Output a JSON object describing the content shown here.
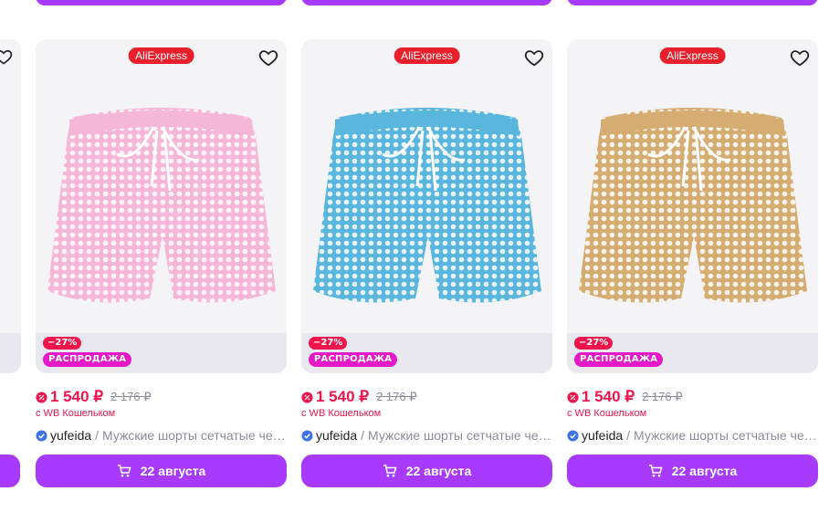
{
  "colors": {
    "accent": "#a73afd",
    "price": "#f0144d",
    "sale": "#e619c9",
    "aliexpress": "#e8202b"
  },
  "products": [
    {
      "store": "AliExpress",
      "discount": "−27%",
      "sale_label": "РАСПРОДАЖА",
      "price": "1 540 ₽",
      "old_price": "2 176 ₽",
      "wallet_note": "с WB Кошельком",
      "brand": "yufeida",
      "separator": "/",
      "name": "Мужские шорты сетчатые черные",
      "delivery": "22 августа",
      "color_name": "pink",
      "color": "#f6b7d6",
      "icons": [
        "heart-icon",
        "cart-icon",
        "verified-icon",
        "discount-icon"
      ]
    },
    {
      "store": "AliExpress",
      "discount": "−27%",
      "sale_label": "РАСПРОДАЖА",
      "price": "1 540 ₽",
      "old_price": "2 176 ₽",
      "wallet_note": "с WB Кошельком",
      "brand": "yufeida",
      "separator": "/",
      "name": "Мужские шорты сетчатые черные",
      "delivery": "22 августа",
      "color_name": "blue",
      "color": "#5ab6dd",
      "icons": [
        "heart-icon",
        "cart-icon",
        "verified-icon",
        "discount-icon"
      ]
    },
    {
      "store": "AliExpress",
      "discount": "−27%",
      "sale_label": "РАСПРОДАЖА",
      "price": "1 540 ₽",
      "old_price": "2 176 ₽",
      "wallet_note": "с WB Кошельком",
      "brand": "yufeida",
      "separator": "/",
      "name": "Мужские шорты сетчатые черные",
      "delivery": "22 августа",
      "color_name": "beige",
      "color": "#d5ad72",
      "icons": [
        "heart-icon",
        "cart-icon",
        "verified-icon",
        "discount-icon"
      ]
    }
  ]
}
